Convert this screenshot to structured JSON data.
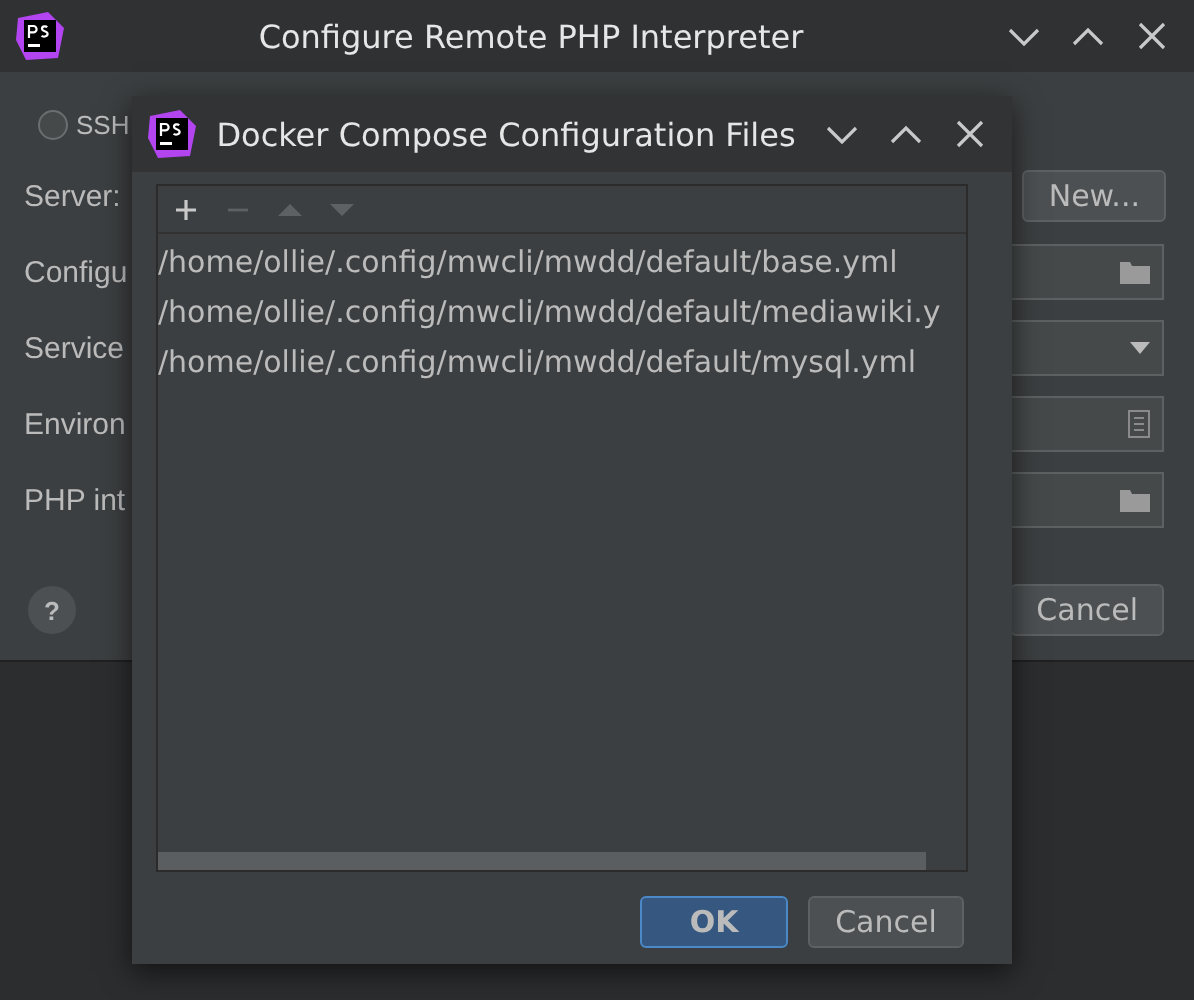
{
  "window": {
    "title": "Configure Remote PHP Interpreter"
  },
  "form": {
    "radio": {
      "label": "SSH",
      "selected": false
    },
    "rows": [
      {
        "label": "Server:",
        "kind": "button",
        "button": "New..."
      },
      {
        "label": "Configu",
        "kind": "folder"
      },
      {
        "label": "Service",
        "kind": "dropdown"
      },
      {
        "label": "Environ",
        "kind": "document"
      },
      {
        "label": "PHP int",
        "kind": "folder"
      }
    ]
  },
  "help": "?",
  "buttons": [
    "Cancel"
  ],
  "dialog": {
    "title": "Docker Compose Configuration Files",
    "toolbar": [
      {
        "kind": "add",
        "disabled": false
      },
      {
        "kind": "remove",
        "disabled": true
      },
      {
        "kind": "up",
        "disabled": true
      },
      {
        "kind": "down",
        "disabled": true
      }
    ],
    "files": [
      "/home/ollie/.config/mwcli/mwdd/default/base.yml",
      "/home/ollie/.config/mwcli/mwdd/default/mediawiki.y",
      "/home/ollie/.config/mwcli/mwdd/default/mysql.yml"
    ],
    "buttons": [
      {
        "label": "OK",
        "default": true
      },
      {
        "label": "Cancel",
        "default": false
      }
    ]
  }
}
